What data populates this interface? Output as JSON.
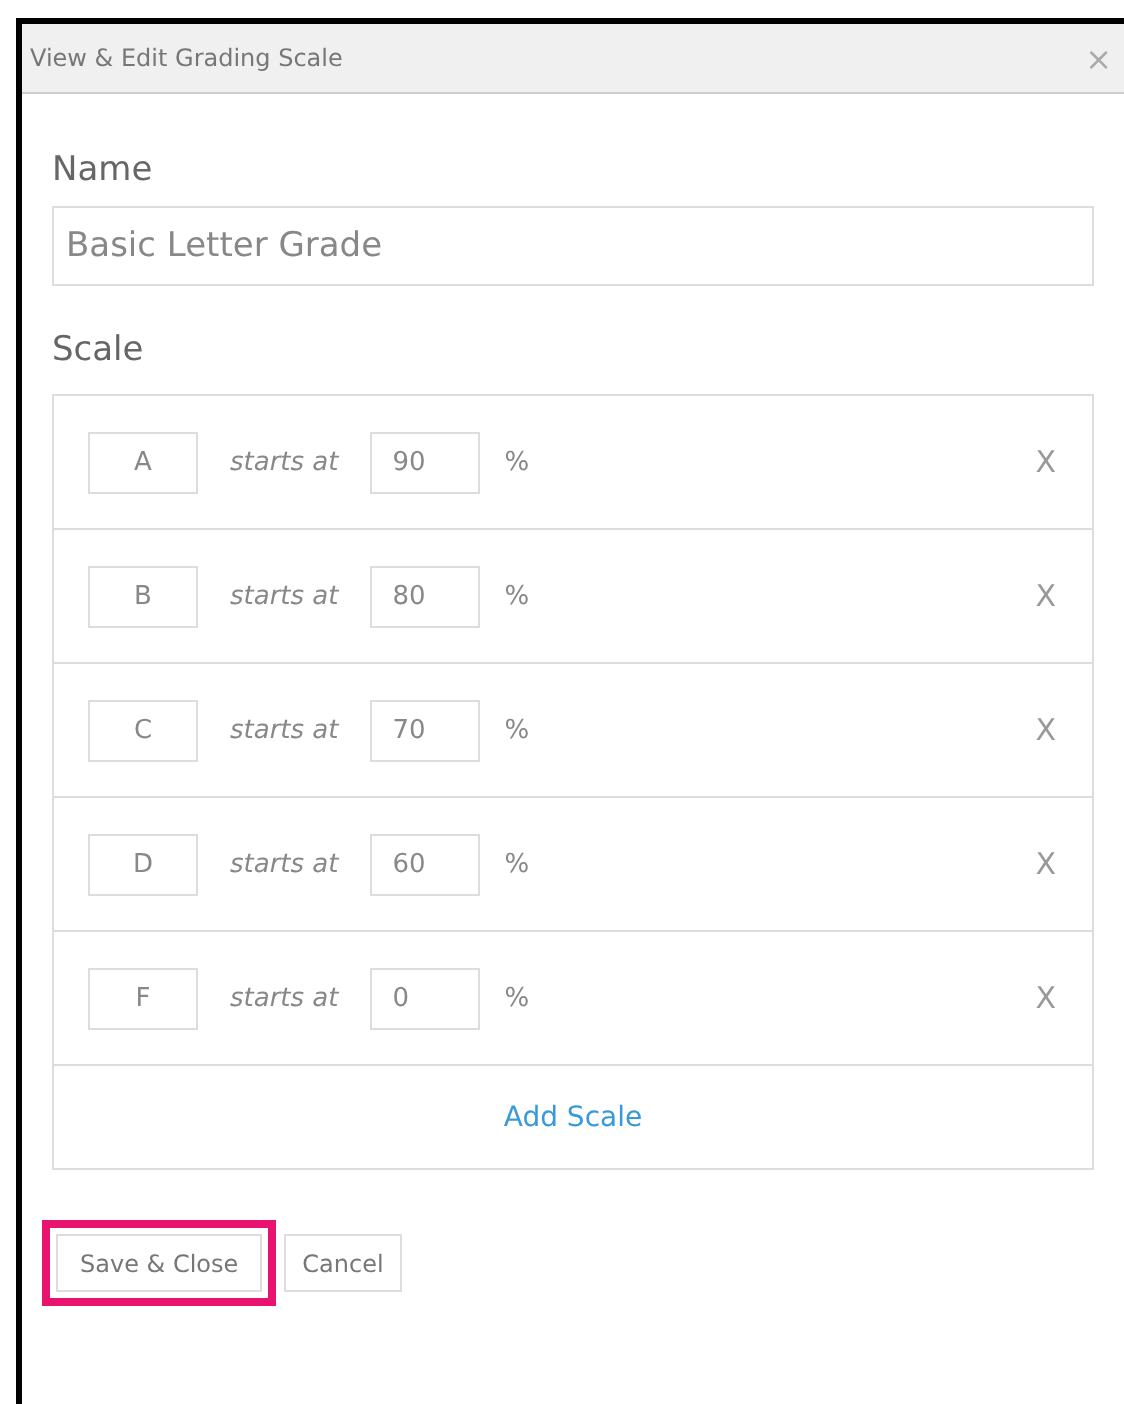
{
  "window": {
    "title": "View & Edit Grading Scale",
    "close": "×"
  },
  "name_field": {
    "label": "Name",
    "value": "Basic Letter Grade"
  },
  "scale": {
    "label": "Scale",
    "add": "Add Scale",
    "rows": [
      {
        "letter": "A",
        "connector": "starts at",
        "value": "90",
        "unit": "%",
        "remove": "X"
      },
      {
        "letter": "B",
        "connector": "starts at",
        "value": "80",
        "unit": "%",
        "remove": "X"
      },
      {
        "letter": "C",
        "connector": "starts at",
        "value": "70",
        "unit": "%",
        "remove": "X"
      },
      {
        "letter": "D",
        "connector": "starts at",
        "value": "60",
        "unit": "%",
        "remove": "X"
      },
      {
        "letter": "F",
        "connector": "starts at",
        "value": "0",
        "unit": "%",
        "remove": "X"
      }
    ]
  },
  "buttons": [
    {
      "label": "Save & Close",
      "highlighted": true
    },
    {
      "label": "Cancel",
      "highlighted": false
    }
  ]
}
